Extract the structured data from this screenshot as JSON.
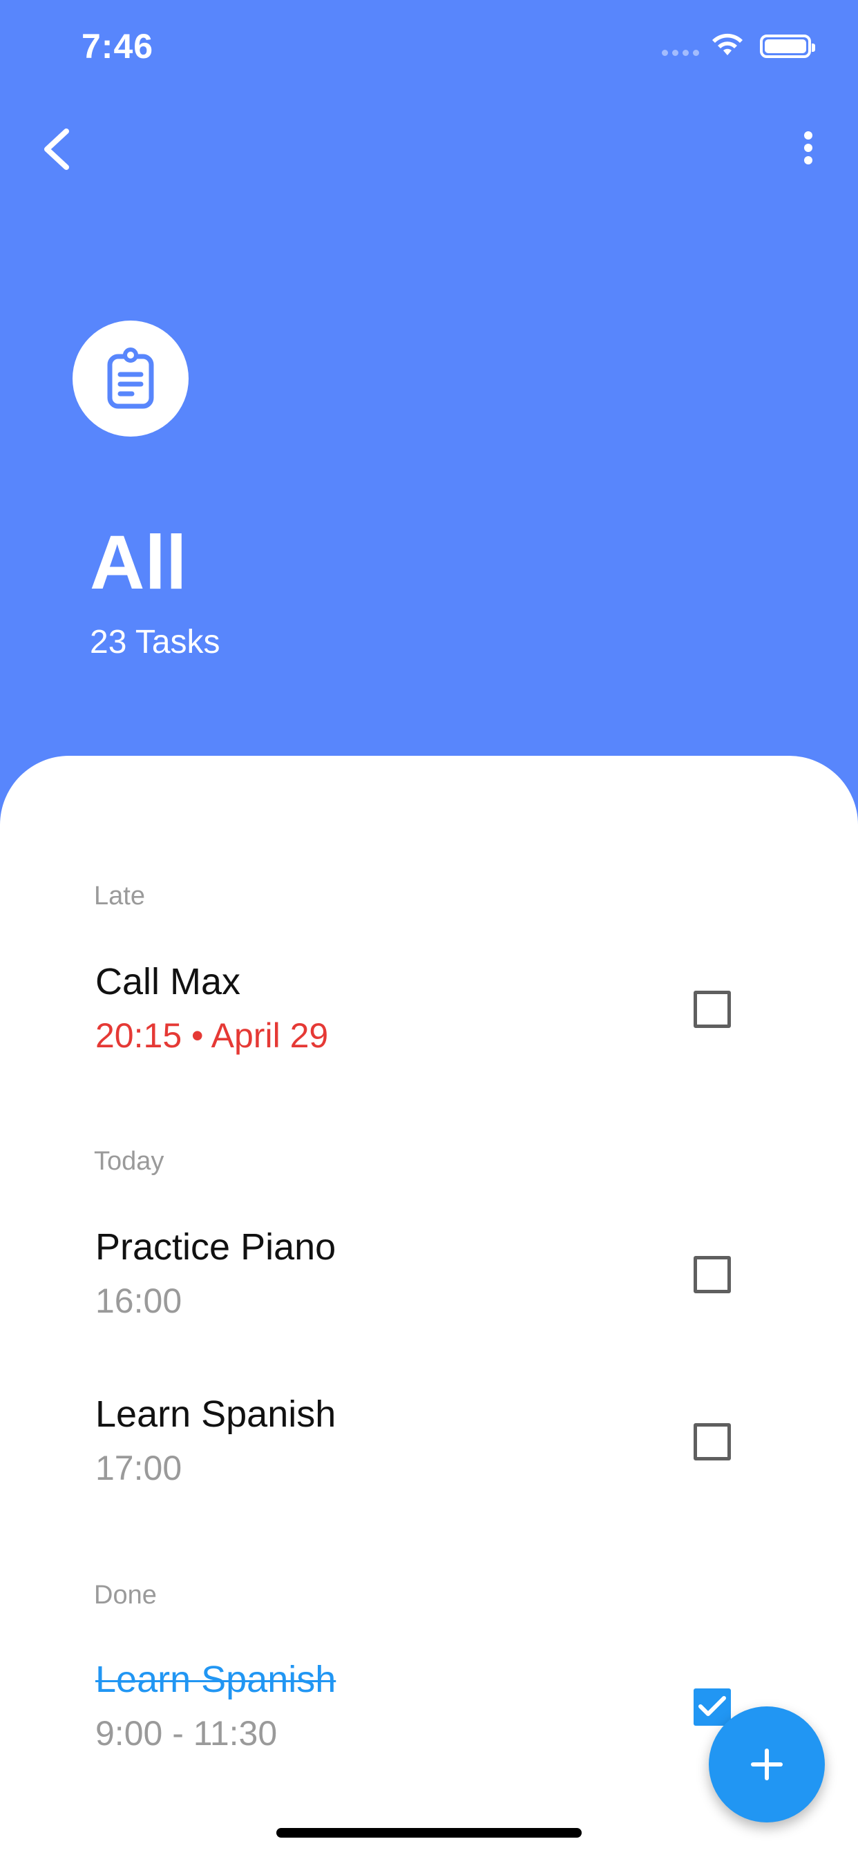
{
  "status_bar": {
    "time": "7:46"
  },
  "header": {
    "list_icon": "clipboard-icon",
    "title": "All",
    "task_count": "23 Tasks",
    "background_color": "#5886FC"
  },
  "sections": {
    "late": {
      "label": "Late",
      "tasks": [
        {
          "title": "Call Max",
          "subtitle": "20:15 • April 29",
          "checked": false
        }
      ]
    },
    "today": {
      "label": "Today",
      "tasks": [
        {
          "title": "Practice Piano",
          "subtitle": "16:00",
          "checked": false
        },
        {
          "title": "Learn Spanish",
          "subtitle": "17:00",
          "checked": false
        }
      ]
    },
    "done": {
      "label": "Done",
      "tasks": [
        {
          "title": "Learn Spanish",
          "subtitle": "9:00 - 11:30",
          "checked": true
        }
      ]
    }
  },
  "colors": {
    "accent": "#2196F3",
    "late": "#E53935",
    "muted": "#9A9A9A"
  },
  "icons": {
    "back": "chevron-left-icon",
    "more": "more-vertical-icon",
    "add": "plus-icon"
  }
}
